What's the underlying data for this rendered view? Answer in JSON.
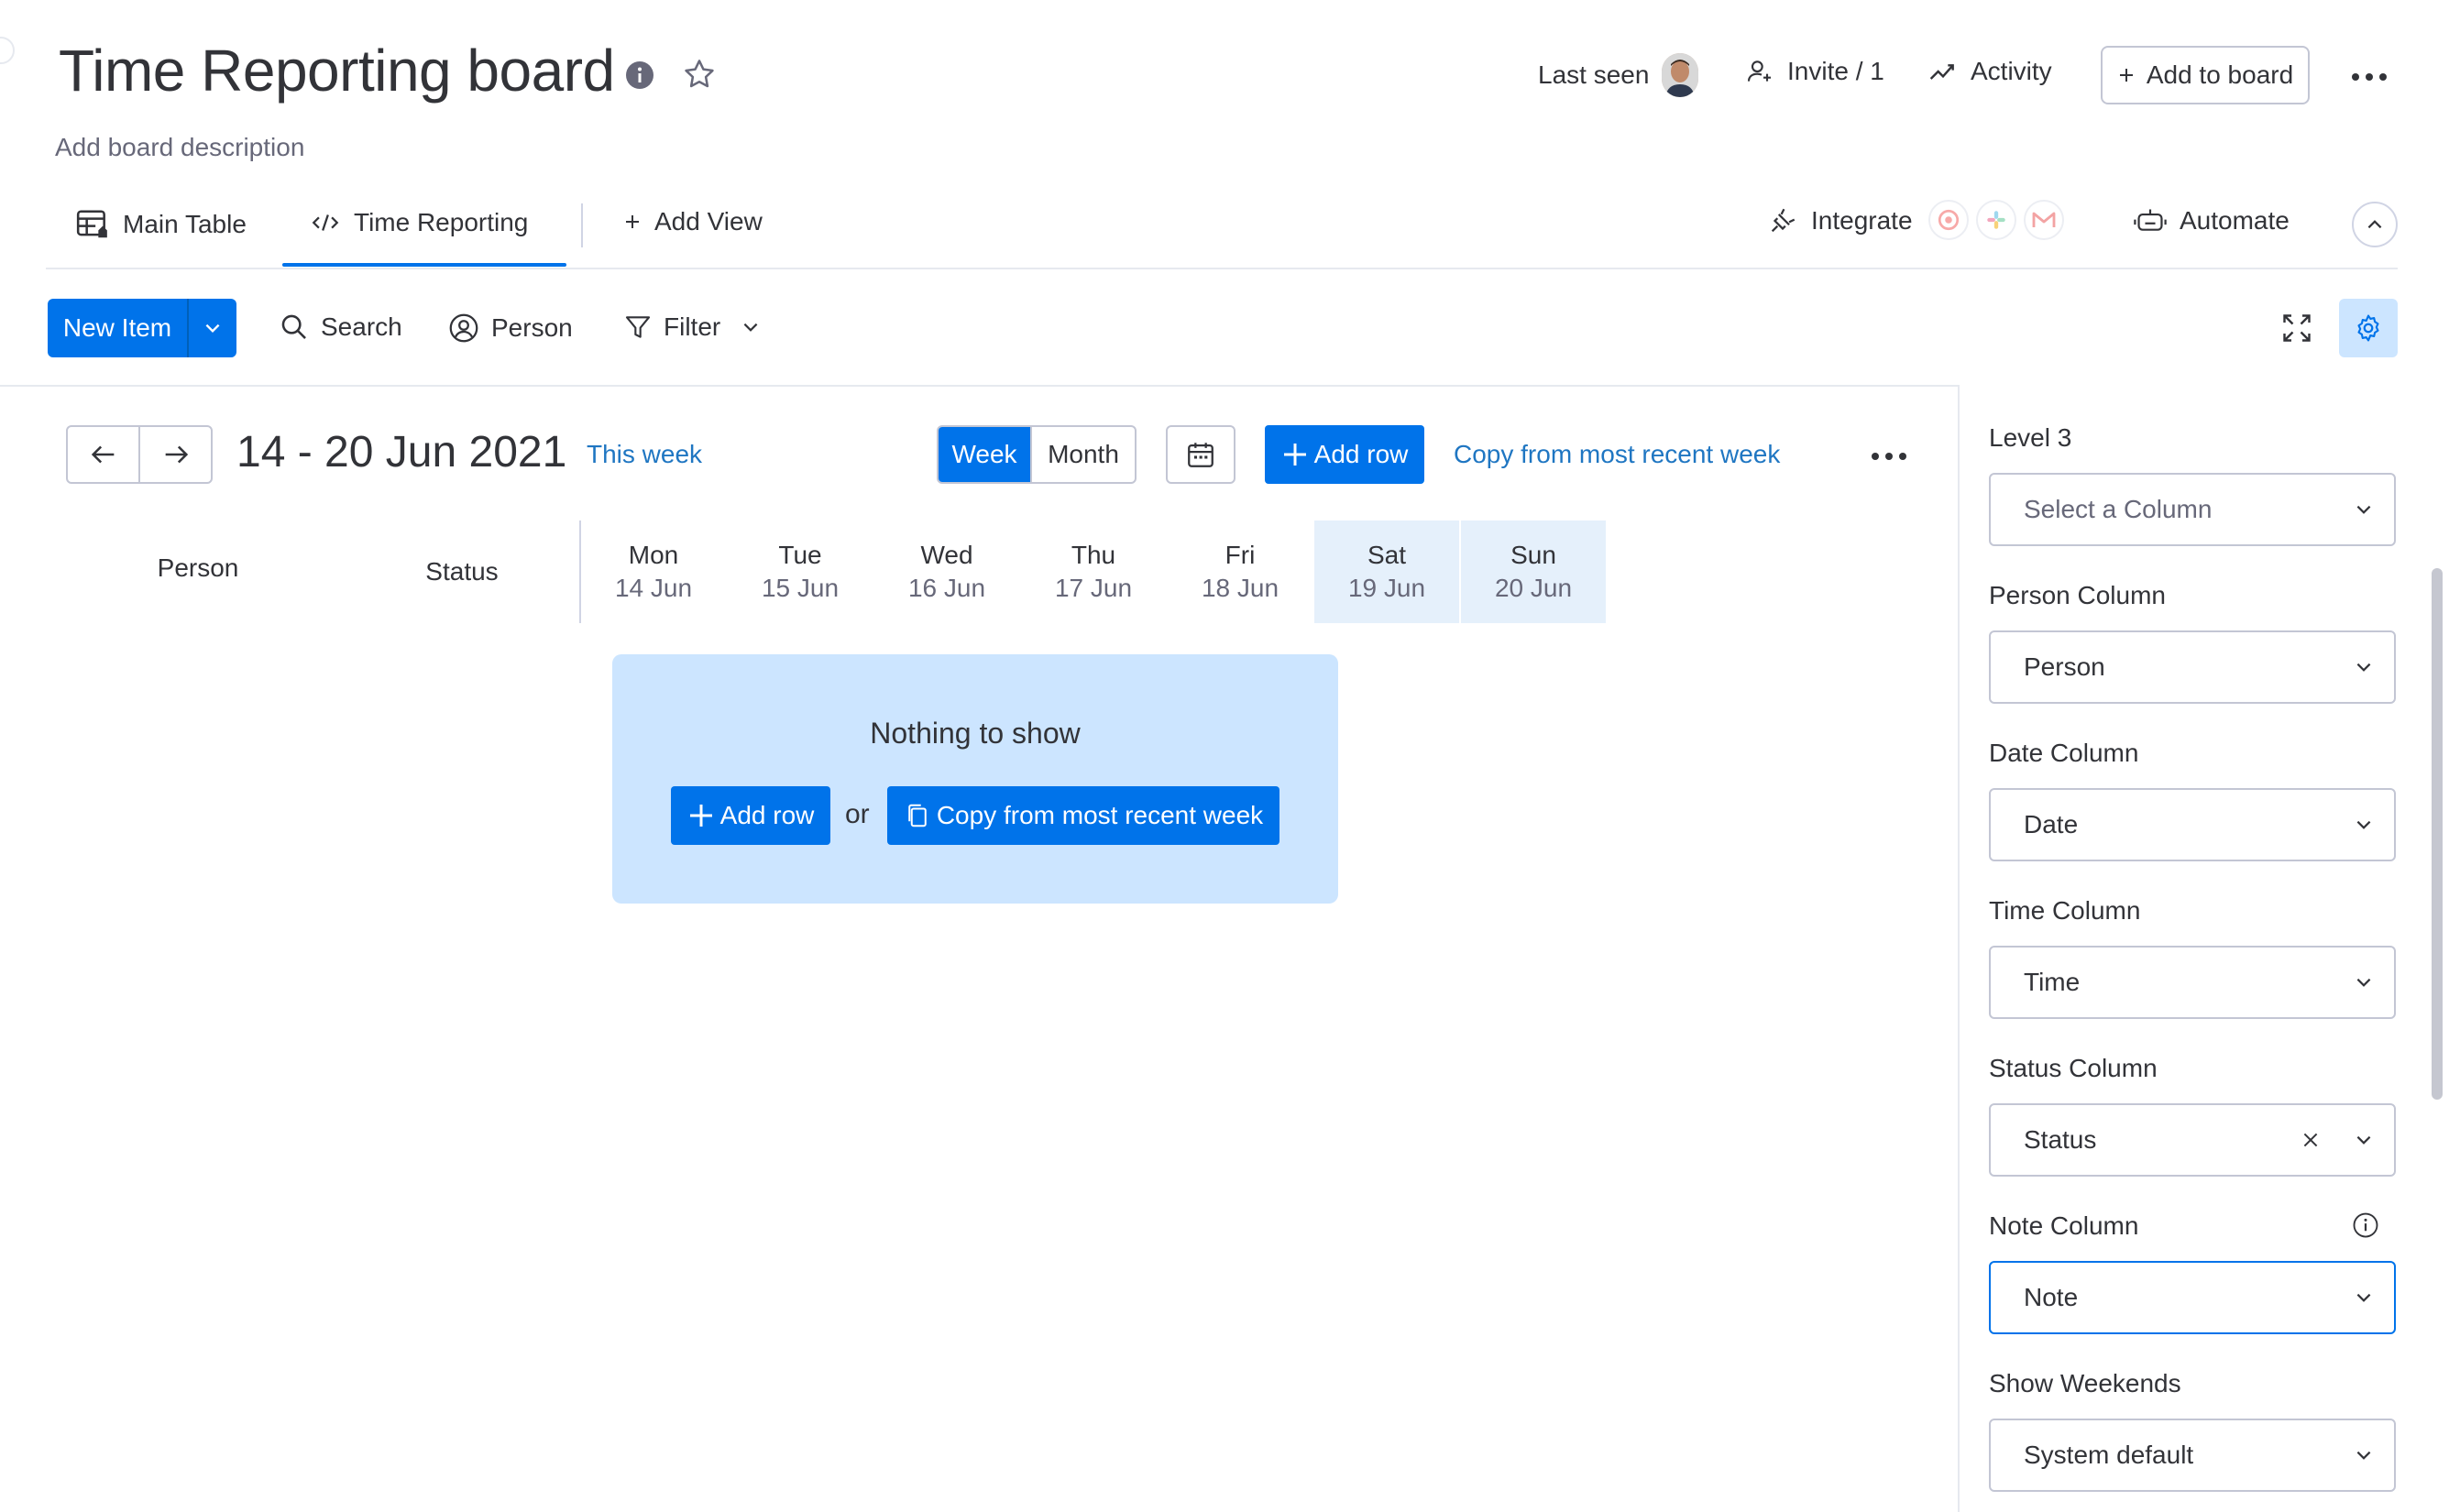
{
  "board": {
    "title": "Time Reporting board",
    "description": "Add board description"
  },
  "header": {
    "last_seen": "Last seen",
    "invite": "Invite / 1",
    "activity": "Activity",
    "add_to_board": "Add to board"
  },
  "tabs": [
    {
      "label": "Main Table",
      "icon": "table-icon",
      "active": false
    },
    {
      "label": "Time Reporting",
      "icon": "code-icon",
      "active": true
    },
    {
      "label": "Add View",
      "icon": "plus-icon",
      "active": false
    }
  ],
  "integrations": {
    "integrate_label": "Integrate",
    "automate_label": "Automate"
  },
  "toolbar": {
    "new_item": "New Item",
    "search": "Search",
    "person": "Person",
    "filter": "Filter"
  },
  "week_view": {
    "date_range": "14 - 20 Jun 2021",
    "this_week": "This week",
    "week_label": "Week",
    "month_label": "Month",
    "add_row": "Add row",
    "copy_recent": "Copy from most recent week"
  },
  "grid": {
    "person_header": "Person",
    "status_header": "Status",
    "days": [
      {
        "name": "Mon",
        "date": "14 Jun",
        "weekend": false
      },
      {
        "name": "Tue",
        "date": "15 Jun",
        "weekend": false
      },
      {
        "name": "Wed",
        "date": "16 Jun",
        "weekend": false
      },
      {
        "name": "Thu",
        "date": "17 Jun",
        "weekend": false
      },
      {
        "name": "Fri",
        "date": "18 Jun",
        "weekend": false
      },
      {
        "name": "Sat",
        "date": "19 Jun",
        "weekend": true
      },
      {
        "name": "Sun",
        "date": "20 Jun",
        "weekend": true
      }
    ]
  },
  "empty_state": {
    "title": "Nothing to show",
    "add_row": "Add row",
    "or": "or",
    "copy_recent": "Copy from most recent week"
  },
  "settings": [
    {
      "label": "Level 3",
      "value": "Select a Column",
      "placeholder": true
    },
    {
      "label": "Person Column",
      "value": "Person"
    },
    {
      "label": "Date Column",
      "value": "Date"
    },
    {
      "label": "Time Column",
      "value": "Time"
    },
    {
      "label": "Status Column",
      "value": "Status",
      "clearable": true
    },
    {
      "label": "Note Column",
      "value": "Note",
      "info": true,
      "focused": true
    },
    {
      "label": "Show Weekends",
      "value": "System default"
    }
  ],
  "colors": {
    "primary": "#0073ea",
    "primary_light": "#cce5ff",
    "link": "#1f76c2",
    "text": "#323338",
    "muted": "#676879",
    "border": "#c3c6d4"
  }
}
